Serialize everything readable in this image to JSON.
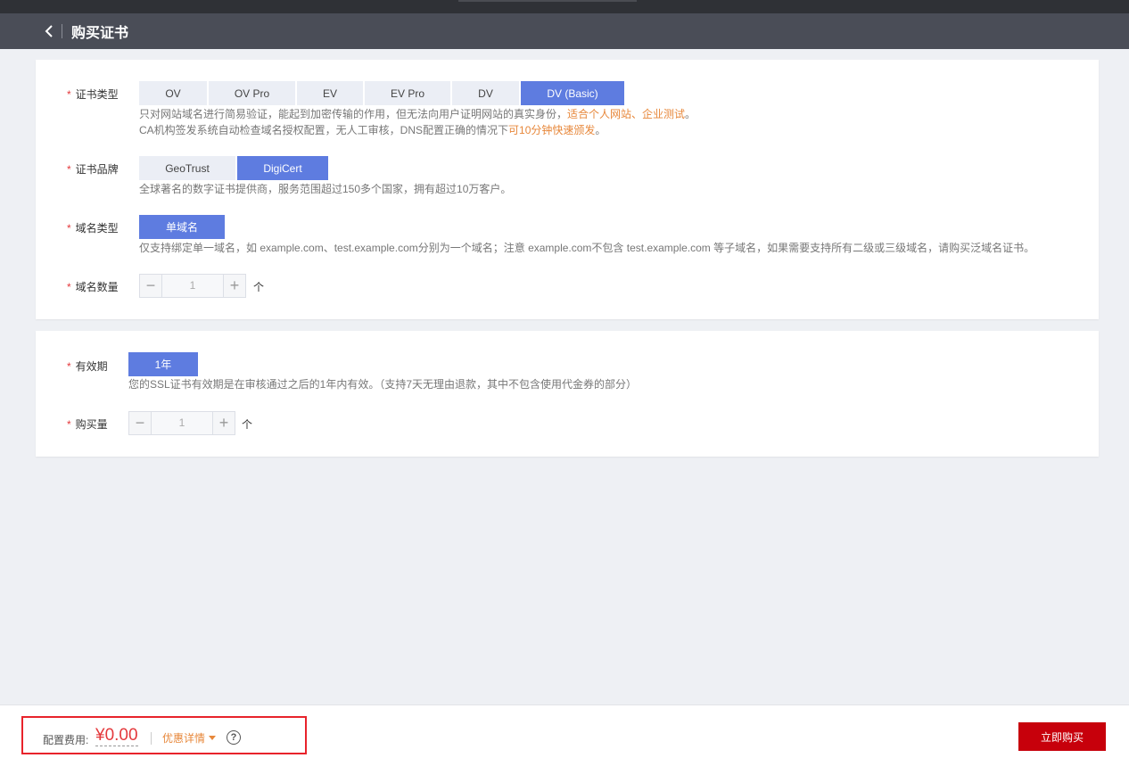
{
  "header": {
    "title": "购买证书",
    "back_icon": "chevron-left-icon"
  },
  "cert_type": {
    "label": "证书类型",
    "options": [
      "OV",
      "OV Pro",
      "EV",
      "EV Pro",
      "DV",
      "DV (Basic)"
    ],
    "selected": "DV (Basic)",
    "desc_line1_a": "只对网站域名进行简易验证，能起到加密传输的作用，但无法向用户证明网站的真实身份，",
    "desc_line1_hl": "适合个人网站、企业测试",
    "desc_line1_b": "。",
    "desc_line2_a": "CA机构签发系统自动检查域名授权配置，无人工审核，DNS配置正确的情况下",
    "desc_line2_hl": "可10分钟快速颁发",
    "desc_line2_b": "。"
  },
  "cert_brand": {
    "label": "证书品牌",
    "options": [
      "GeoTrust",
      "DigiCert"
    ],
    "selected": "DigiCert",
    "desc": "全球著名的数字证书提供商，服务范围超过150多个国家，拥有超过10万客户。"
  },
  "domain_type": {
    "label": "域名类型",
    "options": [
      "单域名"
    ],
    "selected": "单域名",
    "desc": "仅支持绑定单一域名，如 example.com、test.example.com分别为一个域名；注意 example.com不包含 test.example.com 等子域名，如果需要支持所有二级或三级域名，请购买泛域名证书。"
  },
  "domain_count": {
    "label": "域名数量",
    "value": "1",
    "unit": "个"
  },
  "validity": {
    "label": "有效期",
    "options": [
      "1年"
    ],
    "selected": "1年",
    "desc": "您的SSL证书有效期是在审核通过之后的1年内有效。（支持7天无理由退款，其中不包含使用代金券的部分）"
  },
  "purchase_count": {
    "label": "购买量",
    "value": "1",
    "unit": "个"
  },
  "footer": {
    "cost_label": "配置费用:",
    "cost_value": "¥0.00",
    "discount_label": "优惠详情",
    "help_symbol": "?",
    "buy_label": "立即购买"
  },
  "colors": {
    "primary": "#5e7ce0",
    "accent_orange": "#e7873a",
    "price_red": "#e4393c",
    "buy_button": "#c7000b",
    "header_bg": "#4a4d57"
  }
}
